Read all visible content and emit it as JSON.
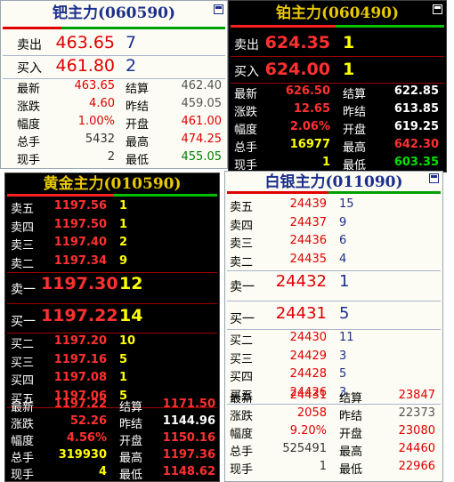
{
  "colors": {
    "red": "#e00000",
    "green": "#008000",
    "gray": "#555555",
    "yellow": "#ffff00",
    "white": "#ffffff",
    "black": "#000000",
    "navy": "#1c2f8c",
    "dkred": "#ff3030",
    "dkgreen": "#00e000"
  },
  "palladium": {
    "title": "钯主力(060590)",
    "ask": {
      "label": "卖出",
      "price": "463.65",
      "vol": "7"
    },
    "bid": {
      "label": "买入",
      "price": "461.80",
      "vol": "2"
    },
    "stats": [
      {
        "l1": "最新",
        "v1": "463.65",
        "l2": "结算",
        "v2": "462.40"
      },
      {
        "l1": "涨跌",
        "v1": "4.60",
        "l2": "昨结",
        "v2": "459.05"
      },
      {
        "l1": "幅度",
        "v1": "1.00%",
        "l2": "开盘",
        "v2": "461.00"
      },
      {
        "l1": "总手",
        "v1": "5432",
        "l2": "最高",
        "v2": "474.25"
      },
      {
        "l1": "现手",
        "v1": "2",
        "l2": "最低",
        "v2": "455.05"
      }
    ]
  },
  "platinum": {
    "title": "铂主力(060490)",
    "ask": {
      "label": "卖出",
      "price": "624.35",
      "vol": "1"
    },
    "bid": {
      "label": "买入",
      "price": "624.00",
      "vol": "1"
    },
    "stats": [
      {
        "l1": "最新",
        "v1": "626.50",
        "l2": "结算",
        "v2": "622.85"
      },
      {
        "l1": "涨跌",
        "v1": "12.65",
        "l2": "昨结",
        "v2": "613.85"
      },
      {
        "l1": "幅度",
        "v1": "2.06%",
        "l2": "开盘",
        "v2": "619.25"
      },
      {
        "l1": "总手",
        "v1": "16977",
        "l2": "最高",
        "v2": "642.30"
      },
      {
        "l1": "现手",
        "v1": "1",
        "l2": "最低",
        "v2": "603.35"
      }
    ]
  },
  "gold": {
    "title": "黄金主力(010590)",
    "asks": [
      {
        "label": "卖五",
        "price": "1197.56",
        "vol": "1"
      },
      {
        "label": "卖四",
        "price": "1197.50",
        "vol": "1"
      },
      {
        "label": "卖三",
        "price": "1197.40",
        "vol": "2"
      },
      {
        "label": "卖二",
        "price": "1197.34",
        "vol": "9"
      }
    ],
    "ask1": {
      "label": "卖一",
      "price": "1197.30",
      "vol": "12"
    },
    "bid1": {
      "label": "买一",
      "price": "1197.22",
      "vol": "14"
    },
    "bids": [
      {
        "label": "买二",
        "price": "1197.20",
        "vol": "10"
      },
      {
        "label": "买三",
        "price": "1197.16",
        "vol": "5"
      },
      {
        "label": "买四",
        "price": "1197.08",
        "vol": "1"
      },
      {
        "label": "买五",
        "price": "1197.06",
        "vol": "5"
      }
    ],
    "stats": [
      {
        "l1": "最新",
        "v1": "1197.22",
        "l2": "结算",
        "v2": "1171.50"
      },
      {
        "l1": "涨跌",
        "v1": "52.26",
        "l2": "昨结",
        "v2": "1144.96"
      },
      {
        "l1": "幅度",
        "v1": "4.56%",
        "l2": "开盘",
        "v2": "1150.16"
      },
      {
        "l1": "总手",
        "v1": "319930",
        "l2": "最高",
        "v2": "1197.36"
      },
      {
        "l1": "现手",
        "v1": "4",
        "l2": "最低",
        "v2": "1148.62"
      }
    ]
  },
  "silver": {
    "title": "白银主力(011090)",
    "asks": [
      {
        "label": "卖五",
        "price": "24439",
        "vol": "15"
      },
      {
        "label": "卖四",
        "price": "24437",
        "vol": "9"
      },
      {
        "label": "卖三",
        "price": "24436",
        "vol": "6"
      },
      {
        "label": "卖二",
        "price": "24435",
        "vol": "4"
      }
    ],
    "ask1": {
      "label": "卖一",
      "price": "24432",
      "vol": "1"
    },
    "bid1": {
      "label": "买一",
      "price": "24431",
      "vol": "5"
    },
    "bids": [
      {
        "label": "买二",
        "price": "24430",
        "vol": "11"
      },
      {
        "label": "买三",
        "price": "24429",
        "vol": "3"
      },
      {
        "label": "买四",
        "price": "24428",
        "vol": "5"
      },
      {
        "label": "买五",
        "price": "24426",
        "vol": "3"
      }
    ],
    "stats": [
      {
        "l1": "最新",
        "v1": "24431",
        "l2": "结算",
        "v2": "23847"
      },
      {
        "l1": "涨跌",
        "v1": "2058",
        "l2": "昨结",
        "v2": "22373"
      },
      {
        "l1": "幅度",
        "v1": "9.20%",
        "l2": "开盘",
        "v2": "23080"
      },
      {
        "l1": "总手",
        "v1": "525491",
        "l2": "最高",
        "v2": "24460"
      },
      {
        "l1": "现手",
        "v1": "1",
        "l2": "最低",
        "v2": "22966"
      }
    ]
  }
}
